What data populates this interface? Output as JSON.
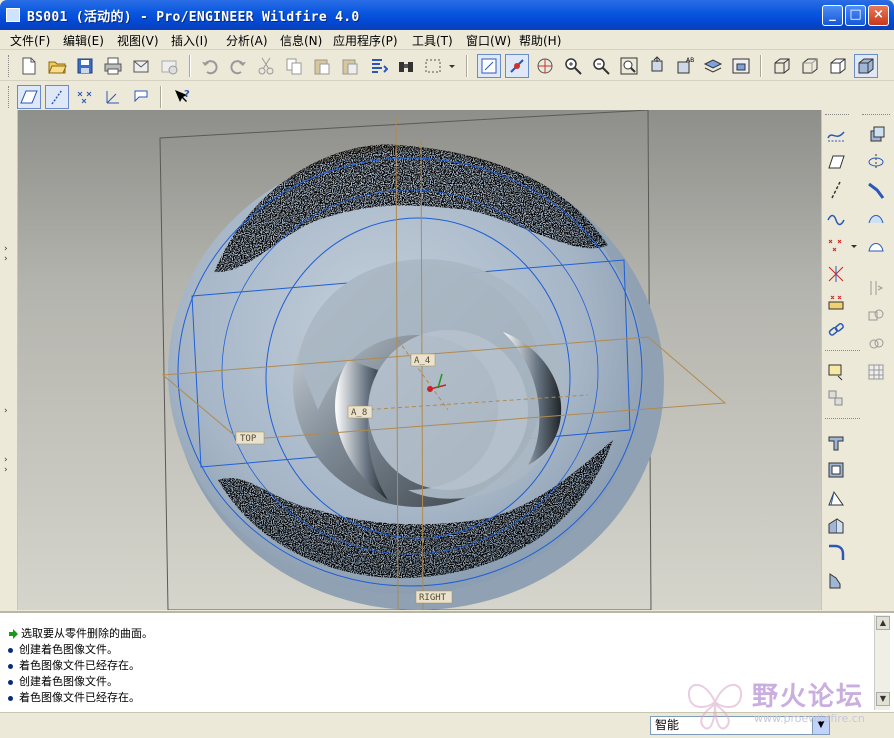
{
  "window": {
    "title": "BS001 (活动的) - Pro/ENGINEER Wildfire 4.0",
    "minimize": "_",
    "maximize": "□",
    "close": "×"
  },
  "menu": [
    "文件(F)",
    "编辑(E)",
    "视图(V)",
    "插入(I)",
    "分析(A)",
    "信息(N)",
    "应用程序(P)",
    "工具(T)",
    "窗口(W)",
    "帮助(H)"
  ],
  "viewport": {
    "datum_labels": {
      "top": "TOP",
      "right": "RIGHT",
      "axis_a4": "A_4",
      "axis_a8": "A_8"
    }
  },
  "messages": [
    {
      "icon": "arrow-icon",
      "text": "选取要从零件删除的曲面。"
    },
    {
      "icon": "bullet-icon",
      "text": "创建着色图像文件。"
    },
    {
      "icon": "bullet-icon",
      "text": "着色图像文件已经存在。"
    },
    {
      "icon": "bullet-icon",
      "text": "创建着色图像文件。"
    },
    {
      "icon": "bullet-icon",
      "text": "着色图像文件已经存在。"
    }
  ],
  "statusbar": {
    "filter_value": "智能"
  },
  "watermark": {
    "title": "野火论坛",
    "url": "www.proewildfire.cn"
  },
  "colors": {
    "titlebar": "#0a58e0",
    "part": "#a9b8c8",
    "datum": "#1f5fd6",
    "plane": "#b08a50"
  }
}
